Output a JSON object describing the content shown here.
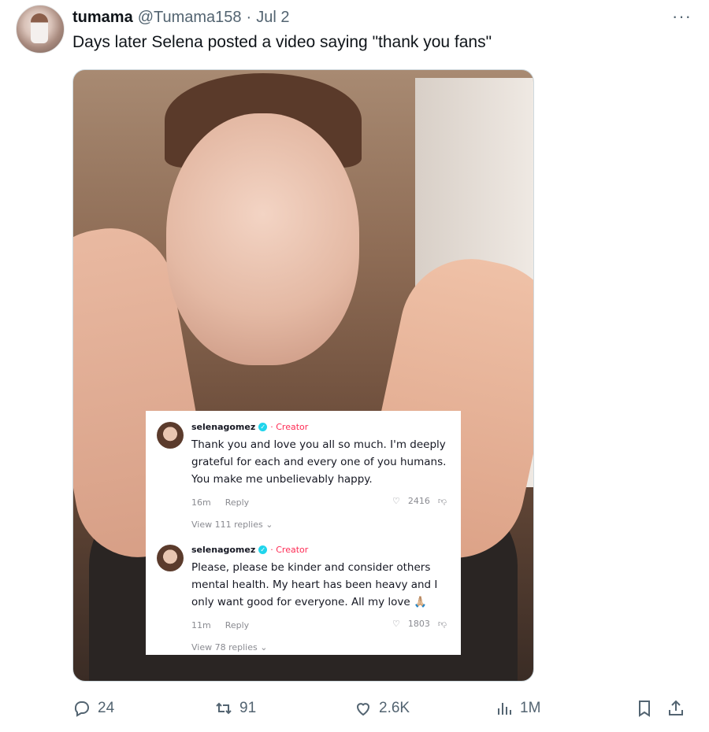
{
  "tweet": {
    "display_name": "tumama",
    "handle": "@Tumama158",
    "separator": "·",
    "date": "Jul 2",
    "more": "···",
    "text": "Days later Selena posted a video saying \"thank you fans\""
  },
  "media": {
    "comments": [
      {
        "username": "selenagomez",
        "badge": "✓",
        "label": "· Creator",
        "text": "Thank you and love you all so much. I'm deeply grateful for each and every one of you humans. You make me unbelievably happy.",
        "time": "16m",
        "reply": "Reply",
        "likes": "2416",
        "view_replies": "View 111 replies ⌄"
      },
      {
        "username": "selenagomez",
        "badge": "✓",
        "label": "· Creator",
        "text": "Please, please be kinder and consider others mental health. My heart has been heavy and I only want good for everyone. All my love 🙏🏼",
        "time": "11m",
        "reply": "Reply",
        "likes": "1803",
        "view_replies": "View 78 replies ⌄"
      }
    ]
  },
  "actions": {
    "replies": "24",
    "retweets": "91",
    "likes": "2.6K",
    "views": "1M"
  },
  "icons": {
    "reply": "reply-icon",
    "retweet": "retweet-icon",
    "like": "heart-icon",
    "views": "views-icon",
    "bookmark": "bookmark-icon",
    "share": "share-icon"
  }
}
